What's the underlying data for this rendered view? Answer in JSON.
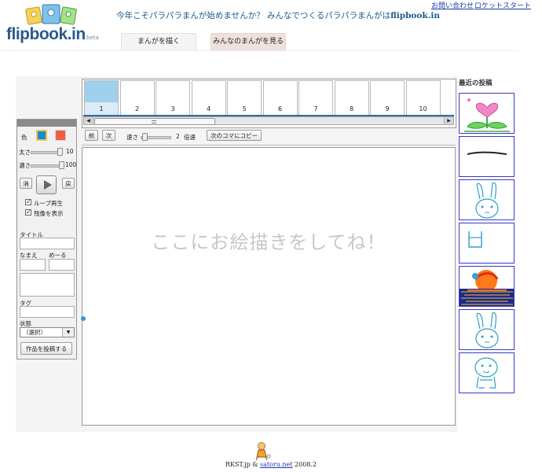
{
  "header": {
    "logo_text": "flipbook.in",
    "logo_badge": "beta",
    "tagline": "今年こそパラパラまんが始めませんか？ みんなでつくるパラパラまんがは",
    "tagline_site": "flipbook.in",
    "links": {
      "contact": "お問い合わせ",
      "rocket_start": "ロケットスタート"
    },
    "tabs": {
      "draw": "まんがを描く",
      "view": "みんなのまんがを見る"
    }
  },
  "frames": {
    "items": [
      "1",
      "2",
      "3",
      "4",
      "5",
      "6",
      "7",
      "8",
      "9",
      "10"
    ],
    "selected": "1"
  },
  "toolbar": {
    "prev": "前",
    "next": "次",
    "speed_label": "速さ",
    "speed_value": "2",
    "speed_unit": "倍速",
    "copy_next": "次のコマにコピー"
  },
  "canvas": {
    "hint": "ここにお絵描きをしてね！"
  },
  "panel": {
    "color_label": "色",
    "colors": {
      "primary": "#1a8ac8",
      "secondary": "#f06040"
    },
    "thickness_label": "太さ",
    "thickness_value": "10",
    "opacity_label": "濃さ",
    "opacity_value": "100",
    "erase": "消",
    "undo": "戻",
    "loop_label": "ループ再生",
    "loop_checked": "✓",
    "onion_label": "残像を表示",
    "onion_checked": "✓",
    "title_label": "タイトル",
    "name_label": "なまえ",
    "mail_label": "めーる",
    "tag_label": "タグ",
    "state_label": "状態",
    "state_value": "（選択）",
    "submit": "作品を投稿する"
  },
  "recent": {
    "title": "最近の投稿"
  },
  "footer": {
    "left": "RKST.jp",
    "amp": "&",
    "link": "satoru.net",
    "year": "2008.2"
  }
}
